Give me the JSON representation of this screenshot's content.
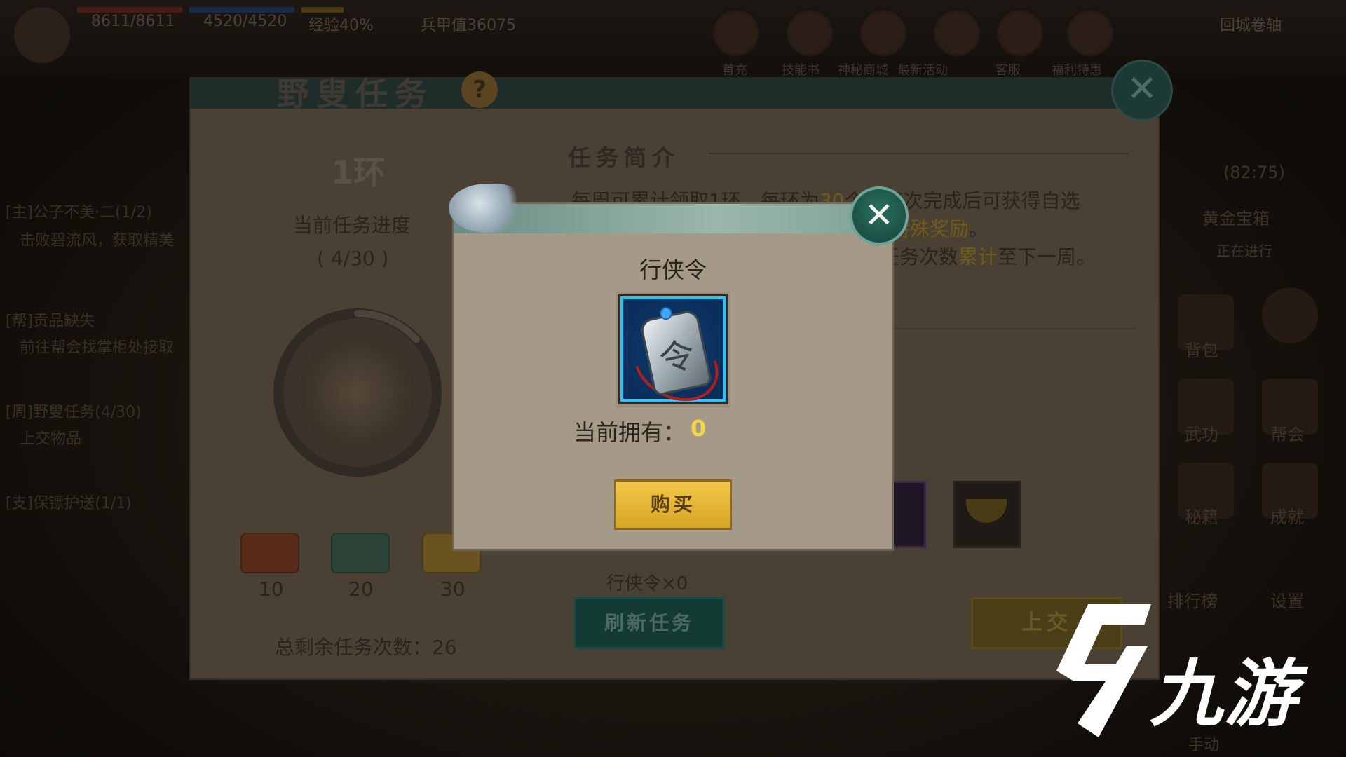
{
  "hud": {
    "hp": "8611/8611",
    "mp": "4520/4520",
    "exp": "经验40%",
    "armor": "兵甲值36075",
    "top_right": "回城卷轴",
    "menu_labels": [
      "首充",
      "技能书",
      "神秘商城",
      "最新活动",
      "客服",
      "福利特惠"
    ]
  },
  "left_quests": [
    "[主]公子不美·二(1/2)",
    "击败碧流风，获取精美",
    "[帮]贡品缺失",
    "前往帮会找掌柜处接取",
    "[周]野叟任务(4/30)",
    "上交物品",
    "[支]保镖护送(1/1)"
  ],
  "right_side": {
    "timer": "(82:75)",
    "labels": [
      "黄金宝箱",
      "正在进行",
      "背包",
      "武功",
      "帮会",
      "秘籍",
      "成就",
      "排行榜",
      "设置",
      "手动"
    ]
  },
  "panel": {
    "title": "野叟任务",
    "help": "?",
    "close": "✕",
    "ring": "1环",
    "progress_label": "当前任务进度",
    "progress_value": "( 4/30 )",
    "progress_fraction": 0.1333,
    "chest_thresholds": [
      "10",
      "20",
      "30"
    ],
    "remaining": "总剩余任务次数：26",
    "intro_title": "任务简介",
    "intro_line1_a": "每周可累计领取1环，每环为",
    "intro_line1_hl": "30",
    "intro_line1_b": "个，每次完成后可获得自选",
    "intro_line2_hl": "特殊奖励",
    "intro_line2_b": "。",
    "intro_line3_a": "任务次数",
    "intro_line3_hl": "累计",
    "intro_line3_b": "至下一周。",
    "token_count": "行侠令×0",
    "refresh_btn": "刷新任务",
    "submit_btn": "上交"
  },
  "popup": {
    "title": "行侠令",
    "item_glyph": "令",
    "own_label": "当前拥有：",
    "own_value": "0",
    "buy_btn": "购买",
    "close": "✕"
  },
  "watermark": {
    "text": "九游"
  },
  "colors": {
    "accent_yellow": "#f1d64a",
    "item_border": "#2ac3ff",
    "close_green": "#2c7060",
    "buy_gold": "#f3c84a"
  }
}
